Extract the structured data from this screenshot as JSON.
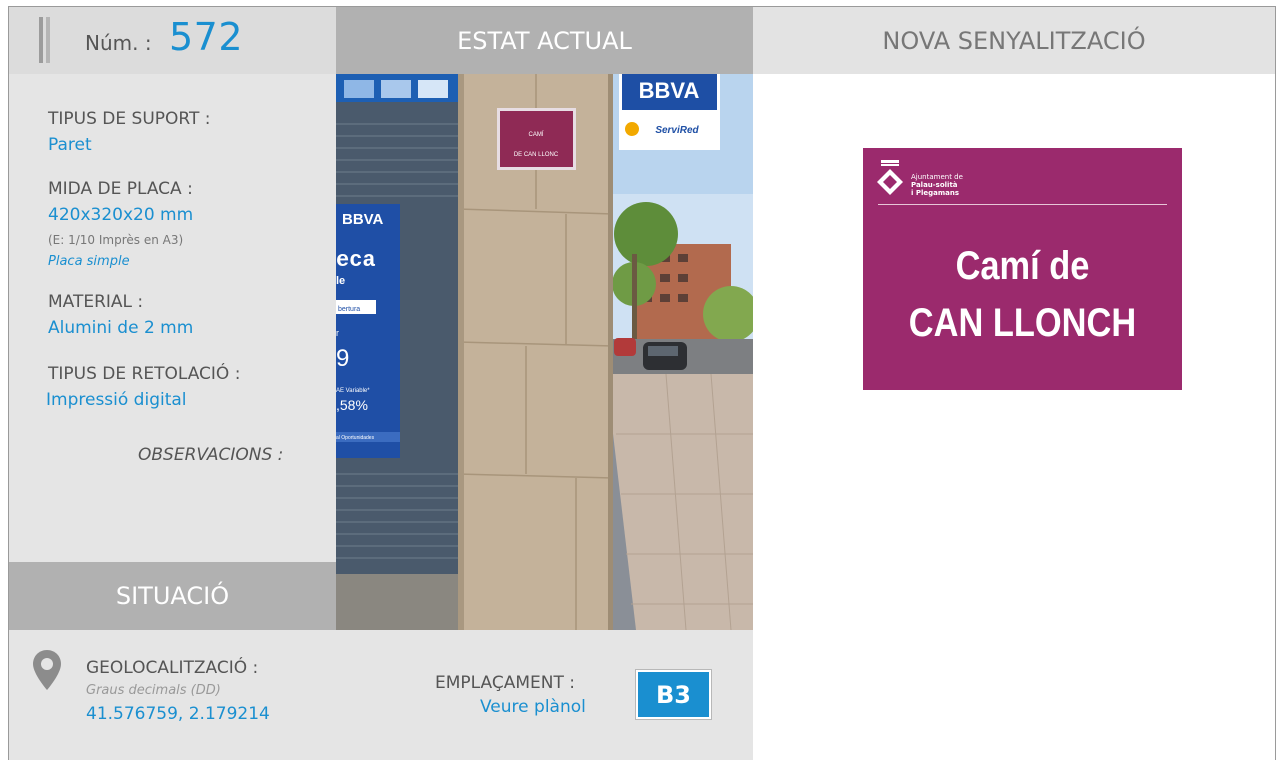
{
  "header": {
    "num_label": "Núm. :",
    "num_value": "572",
    "current_state": "ESTAT ACTUAL",
    "new_signage": "NOVA SENYALITZACIÓ"
  },
  "info": {
    "support_label": "TIPUS DE SUPORT :",
    "support_value": "Paret",
    "size_label": "MIDA DE PLACA :",
    "size_value": "420x320x20 mm",
    "size_scale": "(E: 1/10 Imprès en A3)",
    "size_type": "Placa simple",
    "material_label": "MATERIAL :",
    "material_value": "Alumini de 2 mm",
    "lettering_label": "TIPUS DE RETOLACIÓ :",
    "lettering_value": "Impressió digital",
    "observations_label": "OBSERVACIONS :"
  },
  "situation": {
    "title": "SITUACIÓ",
    "geo_label": "GEOLOCALITZACIÓ :",
    "geo_format": "Graus decimals (DD)",
    "geo_value": "41.576759, 2.179214",
    "location_label": "EMPLAÇAMENT :",
    "location_link": "Veure plànol",
    "location_code": "B3"
  },
  "photo": {
    "bank_name": "BBVA",
    "bank_name_small": "BBVA",
    "network": "ServiRed",
    "old_sign_line1": "CAMÍ",
    "old_sign_line2": "DE CAN LLONC",
    "poster_text_1": "eca",
    "poster_text_2": "le",
    "poster_text_3": "bertura",
    "poster_text_4": "r",
    "poster_text_5": "9",
    "poster_text_6": "AE Variable*",
    "poster_text_7": ",58%",
    "poster_text_8": "al Oportunidades"
  },
  "sign": {
    "org_line1": "Ajuntament de",
    "org_line2": "Palau-solità",
    "org_line3": "i Plegamans",
    "title_line1": "Camí de",
    "title_line2": "CAN LLONCH",
    "color": "#9b2a6d"
  },
  "colors": {
    "accent": "#1a8fd0",
    "header_dark": "#b1b1b1",
    "panel": "#e5e5e5"
  }
}
